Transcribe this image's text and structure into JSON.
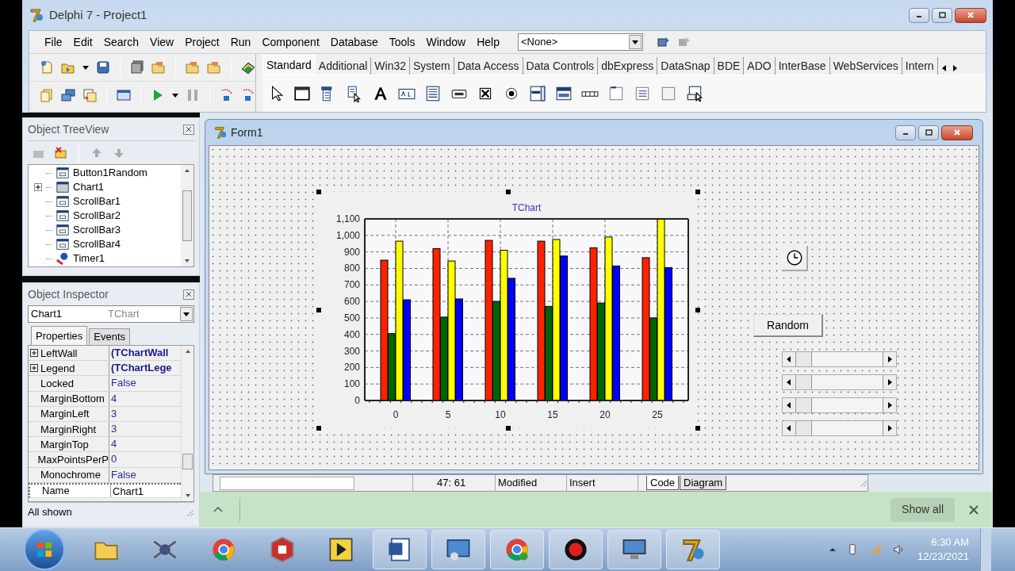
{
  "window": {
    "title": "Delphi 7 - Project1"
  },
  "menu": [
    "File",
    "Edit",
    "Search",
    "View",
    "Project",
    "Run",
    "Component",
    "Database",
    "Tools",
    "Window",
    "Help"
  ],
  "desktop_combo": {
    "value": "<None>"
  },
  "palette_tabs": [
    {
      "label": "Standard",
      "selected": true
    },
    {
      "label": "Additional",
      "selected": false
    },
    {
      "label": "Win32",
      "selected": false
    },
    {
      "label": "System",
      "selected": false
    },
    {
      "label": "Data Access",
      "selected": false
    },
    {
      "label": "Data Controls",
      "selected": false
    },
    {
      "label": "dbExpress",
      "selected": false
    },
    {
      "label": "DataSnap",
      "selected": false
    },
    {
      "label": "BDE",
      "selected": false
    },
    {
      "label": "ADO",
      "selected": false
    },
    {
      "label": "InterBase",
      "selected": false
    },
    {
      "label": "WebServices",
      "selected": false
    },
    {
      "label": "Intern",
      "selected": false
    }
  ],
  "object_treeview": {
    "title": "Object TreeView",
    "items": [
      {
        "label": "Button1Random",
        "kind": "control",
        "collapsed": false
      },
      {
        "label": "Chart1",
        "kind": "chart",
        "collapsed": true
      },
      {
        "label": "ScrollBar1",
        "kind": "control",
        "collapsed": false
      },
      {
        "label": "ScrollBar2",
        "kind": "control",
        "collapsed": false
      },
      {
        "label": "ScrollBar3",
        "kind": "control",
        "collapsed": false
      },
      {
        "label": "ScrollBar4",
        "kind": "control",
        "collapsed": false
      },
      {
        "label": "Timer1",
        "kind": "timer",
        "collapsed": false
      }
    ]
  },
  "object_inspector": {
    "title": "Object Inspector",
    "component": "Chart1",
    "component_type": "TChart",
    "tabs": [
      {
        "label": "Properties",
        "selected": true
      },
      {
        "label": "Events",
        "selected": false
      }
    ],
    "properties": [
      {
        "name": "LeftWall",
        "value": "(TChartWall",
        "kind": "object",
        "selected": false
      },
      {
        "name": "Legend",
        "value": "(TChartLege",
        "kind": "object",
        "selected": false
      },
      {
        "name": "Locked",
        "value": "False",
        "kind": "plain",
        "selected": false
      },
      {
        "name": "MarginBottom",
        "value": "4",
        "kind": "plain",
        "selected": false
      },
      {
        "name": "MarginLeft",
        "value": "3",
        "kind": "plain",
        "selected": false
      },
      {
        "name": "MarginRight",
        "value": "3",
        "kind": "plain",
        "selected": false
      },
      {
        "name": "MarginTop",
        "value": "4",
        "kind": "plain",
        "selected": false
      },
      {
        "name": "MaxPointsPerP",
        "value": "0",
        "kind": "plain",
        "selected": false
      },
      {
        "name": "Monochrome",
        "value": "False",
        "kind": "plain",
        "selected": false
      },
      {
        "name": "Name",
        "value": "Chart1",
        "kind": "plain",
        "selected": true
      }
    ],
    "status": "All shown"
  },
  "form": {
    "title": "Form1",
    "button": "Random",
    "chart": {
      "chart_data": {
        "type": "bar",
        "title": "TChart",
        "categories": [
          "0",
          "5",
          "10",
          "15",
          "20",
          "25"
        ],
        "series": [
          {
            "color": "#ff2200",
            "values": [
              850,
              920,
              970,
              965,
              925,
              865
            ]
          },
          {
            "color": "#006400",
            "values": [
              405,
              505,
              600,
              570,
              590,
              500
            ]
          },
          {
            "color": "#ffff00",
            "values": [
              965,
              845,
              910,
              975,
              990,
              1100
            ]
          },
          {
            "color": "#0000ff",
            "values": [
              610,
              615,
              740,
              875,
              815,
              805
            ]
          }
        ],
        "grid": true,
        "ylim": [
          0,
          1100
        ],
        "yticks": [
          0,
          100,
          200,
          300,
          400,
          500,
          600,
          700,
          800,
          900,
          {
            "value": 1000,
            "label": "1,000"
          },
          {
            "value": 1100,
            "label": "1,100"
          }
        ]
      }
    }
  },
  "editor_status": {
    "position": "47: 61",
    "state": "Modified",
    "mode": "Insert",
    "tabs": [
      {
        "label": "Code",
        "selected": true
      },
      {
        "label": "Diagram",
        "selected": false
      }
    ]
  },
  "download_bar": {
    "button": "Show all"
  },
  "taskbar": {
    "time": "6:30 AM",
    "date": "12/23/2021"
  }
}
